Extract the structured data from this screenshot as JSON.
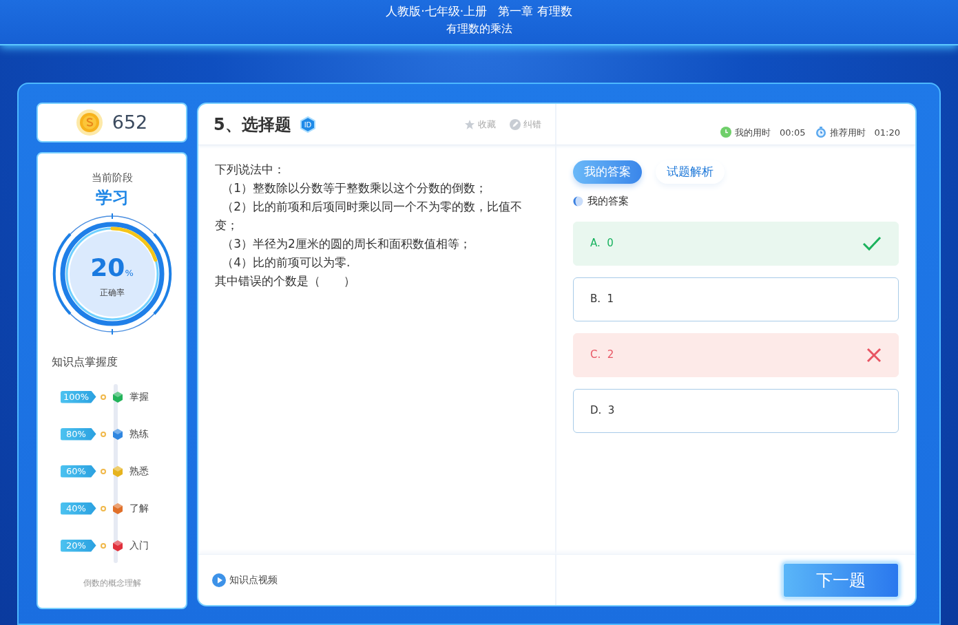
{
  "header": {
    "title": "人教版·七年级·上册   第一章 有理数",
    "subtitle": "有理数的乘法"
  },
  "coins": "652",
  "stage": {
    "label": "当前阶段",
    "value": "学习",
    "accuracy": "20",
    "unit": "%",
    "accuracy_label": "正确率",
    "level": 0.2
  },
  "mastery": {
    "title": "知识点掌握度",
    "levels": [
      {
        "percent": "100%",
        "name": "掌握",
        "color": "#22b35a"
      },
      {
        "percent": "80%",
        "name": "熟练",
        "color": "#2f86e0"
      },
      {
        "percent": "60%",
        "name": "熟悉",
        "color": "#e6b31e"
      },
      {
        "percent": "40%",
        "name": "了解",
        "color": "#e0702a"
      },
      {
        "percent": "20%",
        "name": "入门",
        "color": "#e0303c"
      }
    ],
    "topic": "倒数的概念理解"
  },
  "question": {
    "title": "5、选择题",
    "badge": "ID",
    "actions": [
      {
        "label": "收藏",
        "kind": "star"
      },
      {
        "label": "纠错",
        "kind": "fix"
      }
    ],
    "lines": [
      {
        "text": "下列说法中：",
        "kind": "plain"
      },
      {
        "text": "（1）整数除以分数等于整数乘以这个分数的倒数；",
        "kind": "item"
      },
      {
        "text": "（2）比的前项和后项同时乘以同一个不为零的数，比值不变；",
        "kind": "item"
      },
      {
        "text": "（3）半径为2厘米的圆的周长和面积数值相等；",
        "kind": "item"
      },
      {
        "text": "（4）比的前项可以为零.",
        "kind": "item"
      },
      {
        "text": "其中错误的个数是（　　）",
        "kind": "plain"
      }
    ]
  },
  "timers": [
    {
      "label": "我的用时",
      "value": "00:05",
      "kind": "mine"
    },
    {
      "label": "推荐用时",
      "value": "01:20",
      "kind": "recommended"
    }
  ],
  "tabs": [
    {
      "label": "我的答案",
      "selected": true
    },
    {
      "label": "试题解析",
      "selected": false
    }
  ],
  "answer_label": "我的答案",
  "options": [
    {
      "letter": "A.",
      "text": "0",
      "correct": true,
      "wrong": false
    },
    {
      "letter": "B.",
      "text": "1",
      "correct": false,
      "wrong": false
    },
    {
      "letter": "C.",
      "text": "2",
      "correct": false,
      "wrong": true
    },
    {
      "letter": "D.",
      "text": "3",
      "correct": false,
      "wrong": false
    }
  ],
  "video_link": "知识点视频",
  "next_button": "下一题"
}
